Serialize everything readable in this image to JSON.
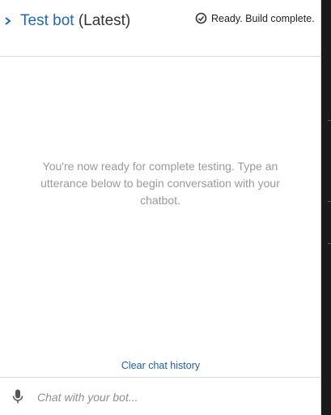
{
  "header": {
    "title": "Test bot",
    "version_label": " (Latest)",
    "status_text": "Ready. Build complete.",
    "icons": {
      "expand": "chevron-right-icon",
      "status": "check-circle-icon"
    }
  },
  "conversation": {
    "empty_message": "You're now ready for complete testing. Type an utterance below to begin conversation with your chatbot."
  },
  "actions": {
    "clear_history_label": "Clear chat history"
  },
  "composer": {
    "placeholder": "Chat with your bot...",
    "value": "",
    "mic_icon": "microphone-icon"
  },
  "colors": {
    "link": "#2266b3",
    "muted_text": "#9a9a9a",
    "panel_bg": "#ffffff",
    "outside_bg": "#1b1b1b"
  }
}
